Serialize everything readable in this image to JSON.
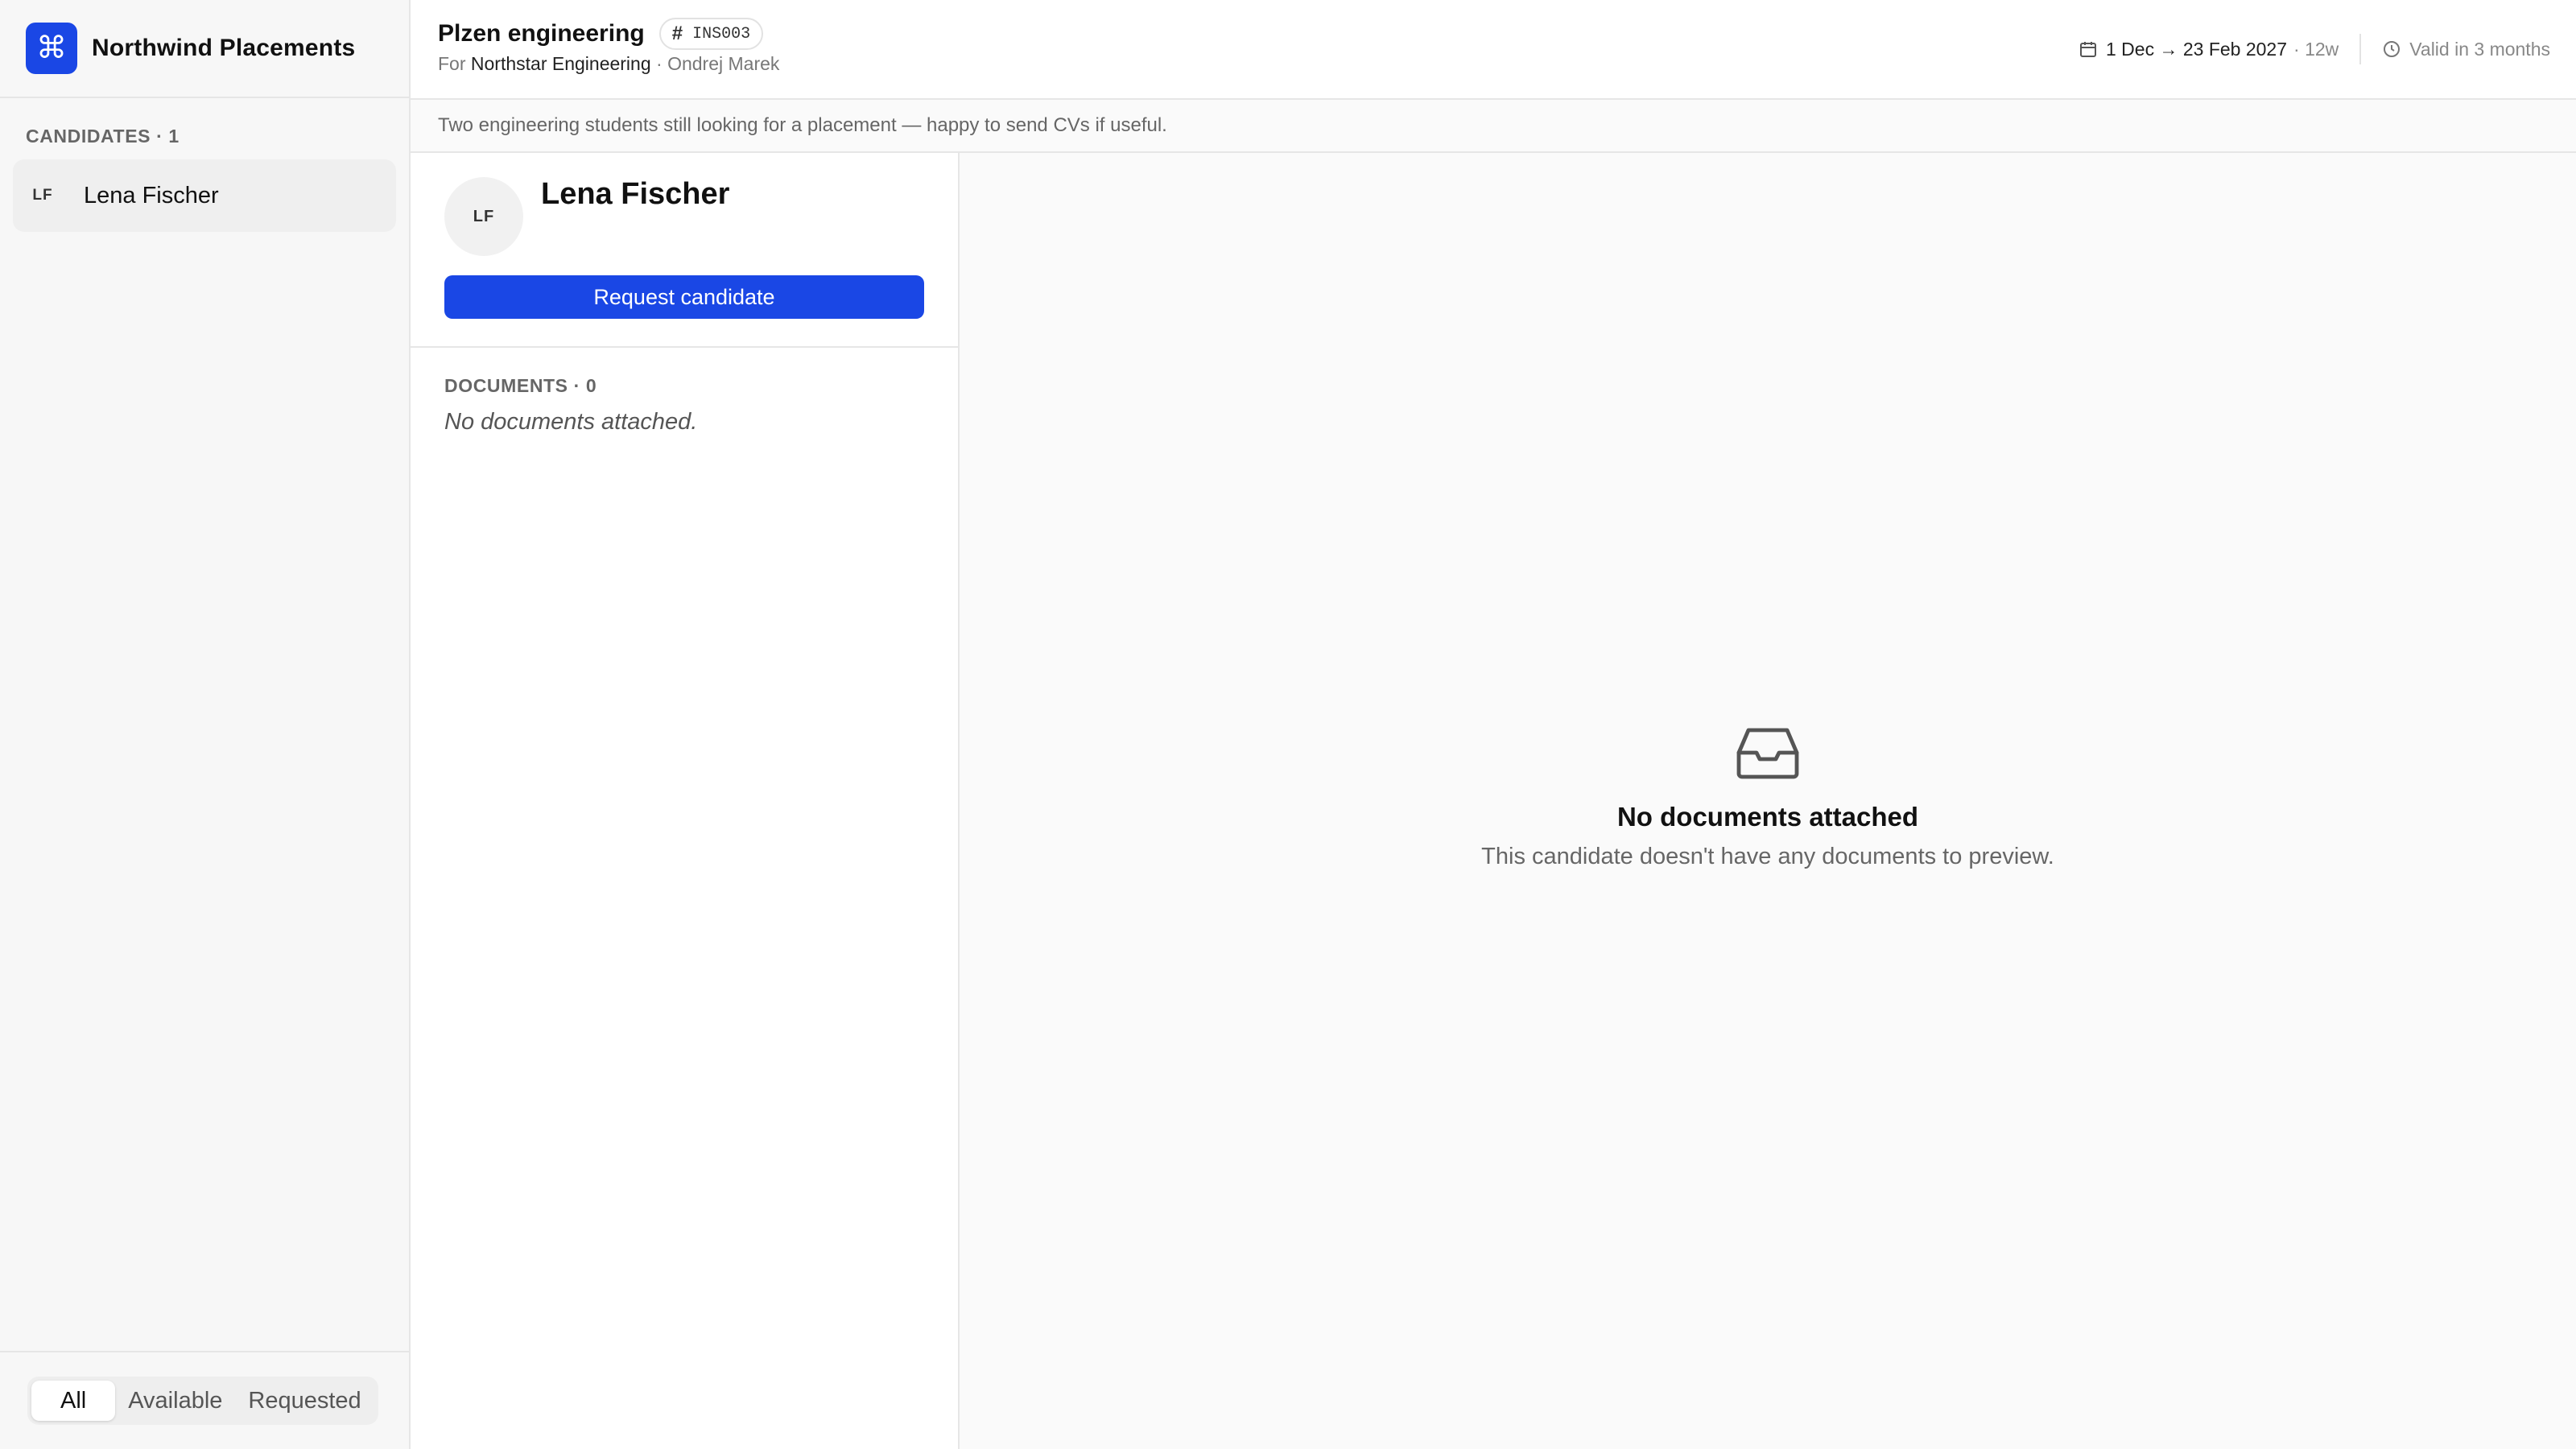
{
  "app": {
    "name": "Northwind Placements",
    "logo_glyph": "⌘",
    "accent_color": "#1a47e5"
  },
  "sidebar": {
    "section_label": "CANDIDATES · 1",
    "candidates": [
      {
        "initials": "LF",
        "name": "Lena Fischer"
      }
    ],
    "filters": [
      "All",
      "Available",
      "Requested"
    ],
    "active_filter": "All"
  },
  "header": {
    "title": "Plzen engineering",
    "code": "INS003",
    "for_prefix": "For",
    "company": "Northstar Engineering",
    "separator": "·",
    "contact": "Ondrej Marek",
    "date_range": "1 Dec → 23 Feb 2027",
    "duration": "· 12w",
    "validity": "Valid in 3 months"
  },
  "note": "Two engineering students still looking for a placement — happy to send CVs if useful.",
  "candidate": {
    "initials": "LF",
    "name": "Lena Fischer",
    "request_label": "Request candidate",
    "documents_label": "DOCUMENTS · 0",
    "documents_empty": "No documents attached."
  },
  "preview": {
    "icon": "inbox-icon",
    "empty_title": "No documents attached",
    "empty_subtitle": "This candidate doesn't have any documents to preview."
  }
}
